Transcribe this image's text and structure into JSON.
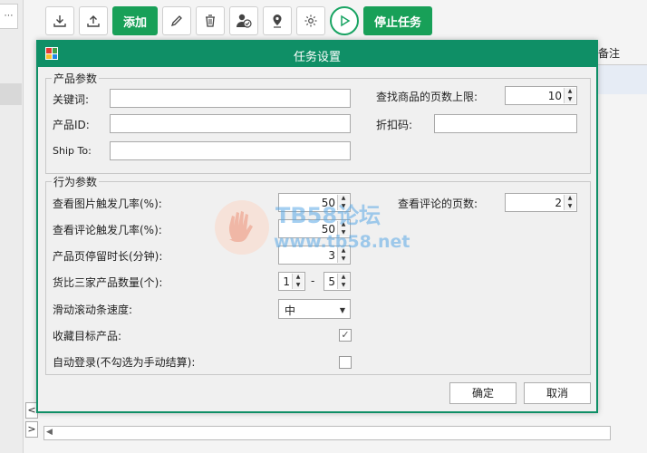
{
  "left_panel": {
    "top_glyph": "⋯"
  },
  "toolbar": {
    "add_label": "添加",
    "stop_label": "停止任务",
    "icons": [
      "download-icon",
      "upload-icon",
      "pencil-icon",
      "trash-icon",
      "user-check-icon",
      "location-pin-icon",
      "gear-icon",
      "play-icon"
    ]
  },
  "grid": {
    "remarks_header": "备注"
  },
  "left_arrows": {
    "left": "<",
    "right": ">"
  },
  "dialog": {
    "title": "任务设置",
    "product_group": {
      "label": "产品参数",
      "keyword_label": "关键词:",
      "keyword_value": "",
      "product_id_label": "产品ID:",
      "product_id_value": "",
      "ship_to_label": "Ship To:",
      "ship_to_value": "",
      "max_pages_label": "查找商品的页数上限:",
      "max_pages_value": "10",
      "discount_code_label": "折扣码:",
      "discount_code_value": ""
    },
    "behavior_group": {
      "label": "行为参数",
      "image_rate_label": "查看图片触发几率(%):",
      "image_rate_value": "50",
      "review_rate_label": "查看评论触发几率(%):",
      "review_rate_value": "50",
      "dwell_label": "产品页停留时长(分钟):",
      "dwell_value": "3",
      "compare_label": "货比三家产品数量(个):",
      "compare_min": "1",
      "compare_dash": "-",
      "compare_max": "5",
      "scroll_speed_label": "滑动滚动条速度:",
      "scroll_speed_value": "中",
      "favorite_label": "收藏目标产品:",
      "favorite_checked": "✓",
      "auto_login_label": "自动登录(不勾选为手动结算):",
      "review_pages_label": "查看评论的页数:",
      "review_pages_value": "2"
    },
    "confirm_label": "确定",
    "cancel_label": "取消"
  },
  "watermark": {
    "line1": "TB58论坛",
    "line2": "www.tb58.net"
  },
  "colors": {
    "accent": "#0f8f66",
    "button_green": "#18a058"
  }
}
